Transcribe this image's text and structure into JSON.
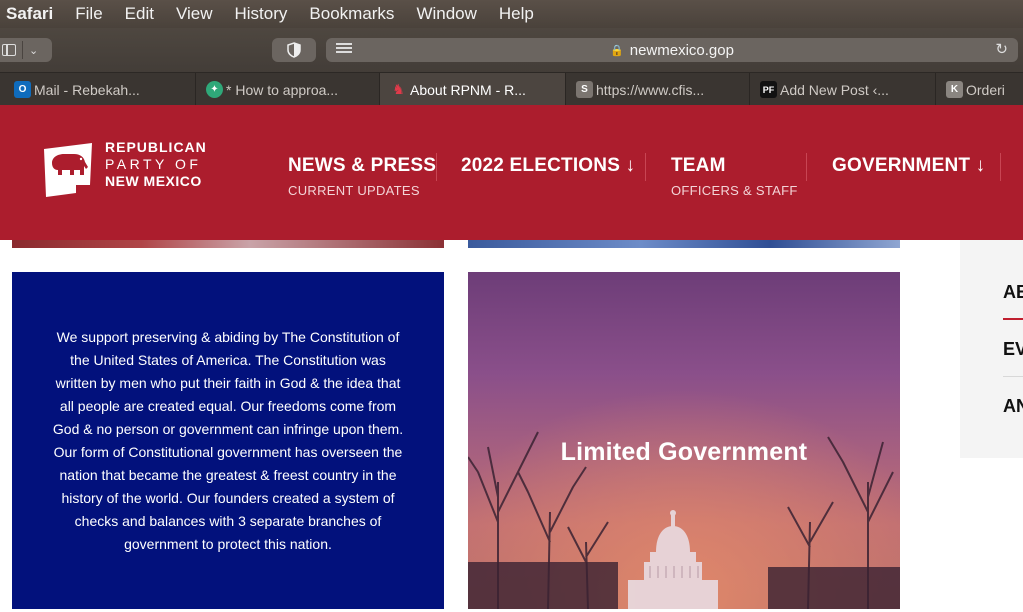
{
  "menubar": {
    "items": [
      "Safari",
      "File",
      "Edit",
      "View",
      "History",
      "Bookmarks",
      "Window",
      "Help"
    ]
  },
  "toolbar": {
    "url": "newmexico.gop",
    "icons": [
      "sidebar-icon",
      "chevron-down-icon",
      "shield-icon",
      "reader-icon",
      "lock-icon",
      "reload-icon"
    ]
  },
  "tabs": [
    {
      "label": "Mail - Rebekah...",
      "favicon": "O",
      "color": "#0f6cbd"
    },
    {
      "label": "* How to approa...",
      "favicon": "",
      "color": "#2fa879"
    },
    {
      "label": "About RPNM - R...",
      "favicon": "",
      "color": "#c01f2f",
      "active": true
    },
    {
      "label": "https://www.cfis...",
      "favicon": "S",
      "color": "#7b7570"
    },
    {
      "label": "Add New Post ‹...",
      "favicon": "PF",
      "color": "#111111"
    },
    {
      "label": "Orderi",
      "favicon": "K",
      "color": "#8a8580"
    }
  ],
  "site": {
    "logo": {
      "line1": "REPUBLICAN",
      "line2": "PARTY OF",
      "line3": "NEW MEXICO"
    },
    "nav": [
      {
        "label": "NEWS & PRESS",
        "sub": "CURRENT UPDATES"
      },
      {
        "label": "2022 ELECTIONS ↓",
        "sub": ""
      },
      {
        "label": "TEAM",
        "sub": "OFFICERS & STAFF"
      },
      {
        "label": "GOVERNMENT ↓",
        "sub": ""
      }
    ],
    "colors": {
      "brand_red": "#ac1d2d",
      "card_blue": "#02117c"
    }
  },
  "content": {
    "constitution_text": "We support preserving & abiding by The Constitution of the United States of America. The Constitution was written by men who put their faith in God & the idea that all people are created equal. Our freedoms come from God & no person or government can infringe upon them. Our form of Constitutional government has overseen the nation that became the greatest & freest country in the history of the world. Our founders created a system of checks and balances with 3 separate branches of government to protect this nation.",
    "image_caption": "Limited Government"
  },
  "sidebar": {
    "items": [
      "AB",
      "EV",
      "AN"
    ]
  }
}
